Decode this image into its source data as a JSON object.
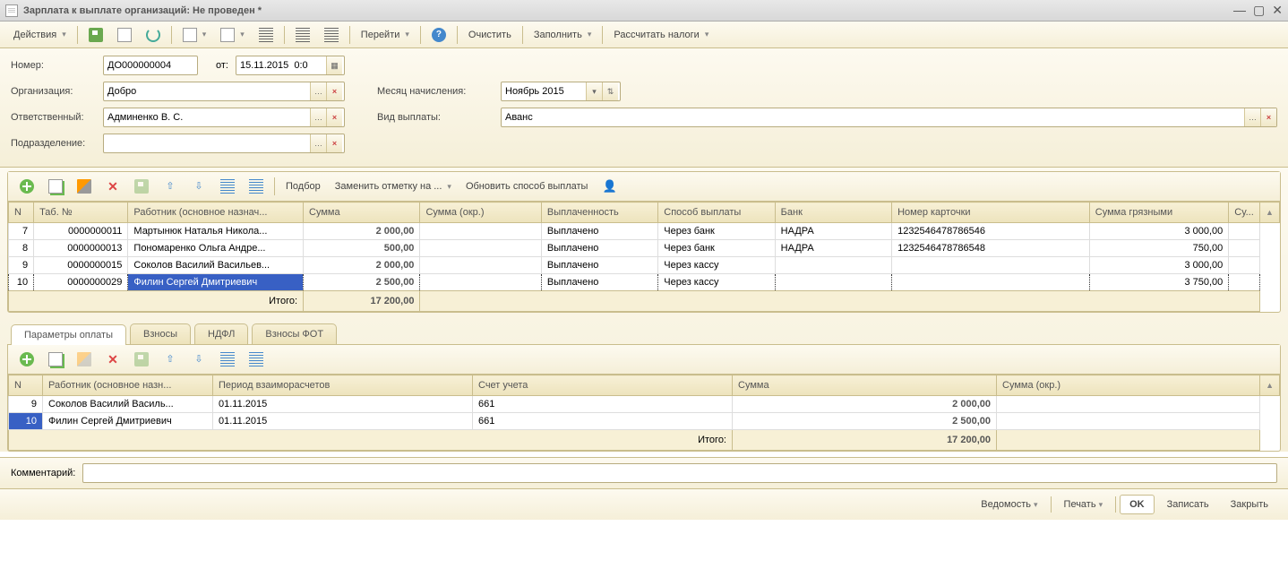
{
  "window": {
    "title": "Зарплата к выплате организаций: Не проведен *"
  },
  "toolbar": {
    "actions": "Действия",
    "goto": "Перейти",
    "clear": "Очистить",
    "fill": "Заполнить",
    "calc": "Рассчитать налоги"
  },
  "form": {
    "number_label": "Номер:",
    "number": "ДО000000004",
    "from_label": "от:",
    "from": "15.11.2015  0:0",
    "org_label": "Организация:",
    "org": "Добро",
    "month_label": "Месяц начисления:",
    "month": "Ноябрь 2015",
    "resp_label": "Ответственный:",
    "resp": "Админенко В. С.",
    "paytype_label": "Вид выплаты:",
    "paytype": "Аванс",
    "dept_label": "Подразделение:",
    "dept": ""
  },
  "tblbar1": {
    "podbor": "Подбор",
    "replace": "Заменить отметку на ...",
    "update": "Обновить способ выплаты"
  },
  "table1": {
    "headers": {
      "n": "N",
      "tab": "Таб. №",
      "emp": "Работник (основное назнач...",
      "sum": "Сумма",
      "sum_okr": "Сумма (окр.)",
      "paid": "Выплаченность",
      "method": "Способ выплаты",
      "bank": "Банк",
      "card": "Номер карточки",
      "dirty": "Сумма грязными",
      "last": "Су..."
    },
    "rows": [
      {
        "n": "7",
        "tab": "0000000011",
        "emp": "Мартынюк Наталья Никола...",
        "sum": "2 000,00",
        "sum_okr": "",
        "paid": "Выплачено",
        "method": "Через банк",
        "bank": "НАДРА",
        "card": "1232546478786546",
        "dirty": "3 000,00"
      },
      {
        "n": "8",
        "tab": "0000000013",
        "emp": "Пономаренко Ольга Андре...",
        "sum": "500,00",
        "sum_okr": "",
        "paid": "Выплачено",
        "method": "Через банк",
        "bank": "НАДРА",
        "card": "1232546478786548",
        "dirty": "750,00"
      },
      {
        "n": "9",
        "tab": "0000000015",
        "emp": "Соколов Василий Васильев...",
        "sum": "2 000,00",
        "sum_okr": "",
        "paid": "Выплачено",
        "method": "Через кассу",
        "bank": "",
        "card": "",
        "dirty": "3 000,00"
      },
      {
        "n": "10",
        "tab": "0000000029",
        "emp": "Филин Сергей Дмитриевич",
        "sum": "2 500,00",
        "sum_okr": "",
        "paid": "Выплачено",
        "method": "Через кассу",
        "bank": "",
        "card": "",
        "dirty": "3 750,00"
      }
    ],
    "total_label": "Итого:",
    "total": "17 200,00"
  },
  "tabs": {
    "t1": "Параметры оплаты",
    "t2": "Взносы",
    "t3": "НДФЛ",
    "t4": "Взносы ФОТ"
  },
  "table2": {
    "headers": {
      "n": "N",
      "emp": "Работник (основное назн...",
      "period": "Период взаиморасчетов",
      "acct": "Счет учета",
      "sum": "Сумма",
      "sum_okr": "Сумма (окр.)"
    },
    "rows": [
      {
        "n": "9",
        "emp": "Соколов Василий Василь...",
        "period": "01.11.2015",
        "acct": "661",
        "sum": "2 000,00",
        "sum_okr": ""
      },
      {
        "n": "10",
        "emp": "Филин Сергей Дмитриевич",
        "period": "01.11.2015",
        "acct": "661",
        "sum": "2 500,00",
        "sum_okr": ""
      }
    ],
    "total_label": "Итого:",
    "total": "17 200,00"
  },
  "comment_label": "Комментарий:",
  "footer": {
    "vedom": "Ведомость",
    "print": "Печать",
    "ok": "OK",
    "save": "Записать",
    "close": "Закрыть"
  }
}
